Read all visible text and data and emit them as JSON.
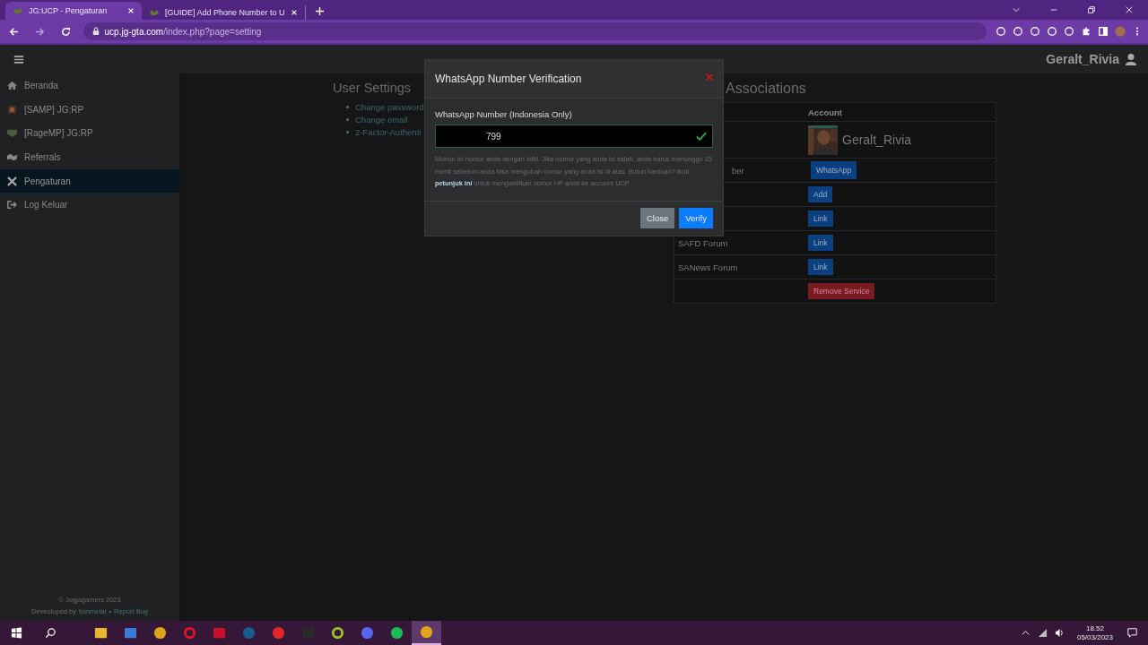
{
  "browser": {
    "tabs": [
      {
        "title": "JG:UCP - Pengaturan",
        "selected": true
      },
      {
        "title": "[GUIDE] Add Phone Number to U",
        "selected": false
      }
    ],
    "url_host": "ucp.jg-gta.com",
    "url_path": "/index.php?page=setting"
  },
  "navbar": {
    "username": "Geralt_Rivia"
  },
  "sidebar": {
    "items": [
      {
        "label": "Beranda",
        "selected": false
      },
      {
        "label": "[SAMP] JG:RP",
        "selected": false
      },
      {
        "label": "[RageMP] JG:RP",
        "selected": false
      },
      {
        "label": "Referrals",
        "selected": false
      },
      {
        "label": "Pengaturan",
        "selected": true
      },
      {
        "label": "Log Keluar",
        "selected": false
      }
    ],
    "footer": {
      "copyright": "© Jogjagamers 2023",
      "developed_by": "Deveoloped by",
      "author": "tianmetal",
      "separator": "•",
      "report_link": "Report Bug"
    }
  },
  "user_settings": {
    "title": "User Settings",
    "links": [
      "Change password",
      "Change email",
      "2-Factor-Authenti"
    ]
  },
  "associations": {
    "title": "Associations",
    "column_2": "Account",
    "rows": [
      {
        "kind": "profile",
        "name": "Geralt_Rivia"
      },
      {
        "kind": "button",
        "label": "ber",
        "button": "WhatsApp"
      },
      {
        "kind": "button",
        "button": "Add"
      },
      {
        "kind": "button",
        "button": "Link"
      },
      {
        "kind": "button",
        "label": "SAFD Forum",
        "button": "Link"
      },
      {
        "kind": "button",
        "label": "SANews Forum",
        "button": "Link"
      },
      {
        "kind": "danger_button",
        "button": "Remove Service"
      }
    ]
  },
  "modal": {
    "title": "WhatsApp Number Verification",
    "field_label": "WhatsApp Number (Indonesia Only)",
    "value": "799",
    "valid": true,
    "help_before": "Mohon isi nomor anda dengan teliti. Jika nomor yang anda isi salah, anda harus menunggu 15 menit sebelum anda bisa mengubah nomor yang anda isi di atas. Butuh bantuan? ikuti",
    "help_link": "petunjuk ini",
    "help_after": "untuk mengaktifkan nomor HP anda ke account UCP.",
    "buttons": [
      {
        "label": "Close",
        "kind": "secondary"
      },
      {
        "label": "Verify",
        "kind": "primary"
      }
    ]
  },
  "taskbar": {
    "time": "18.52",
    "date": "05/03/2023"
  }
}
